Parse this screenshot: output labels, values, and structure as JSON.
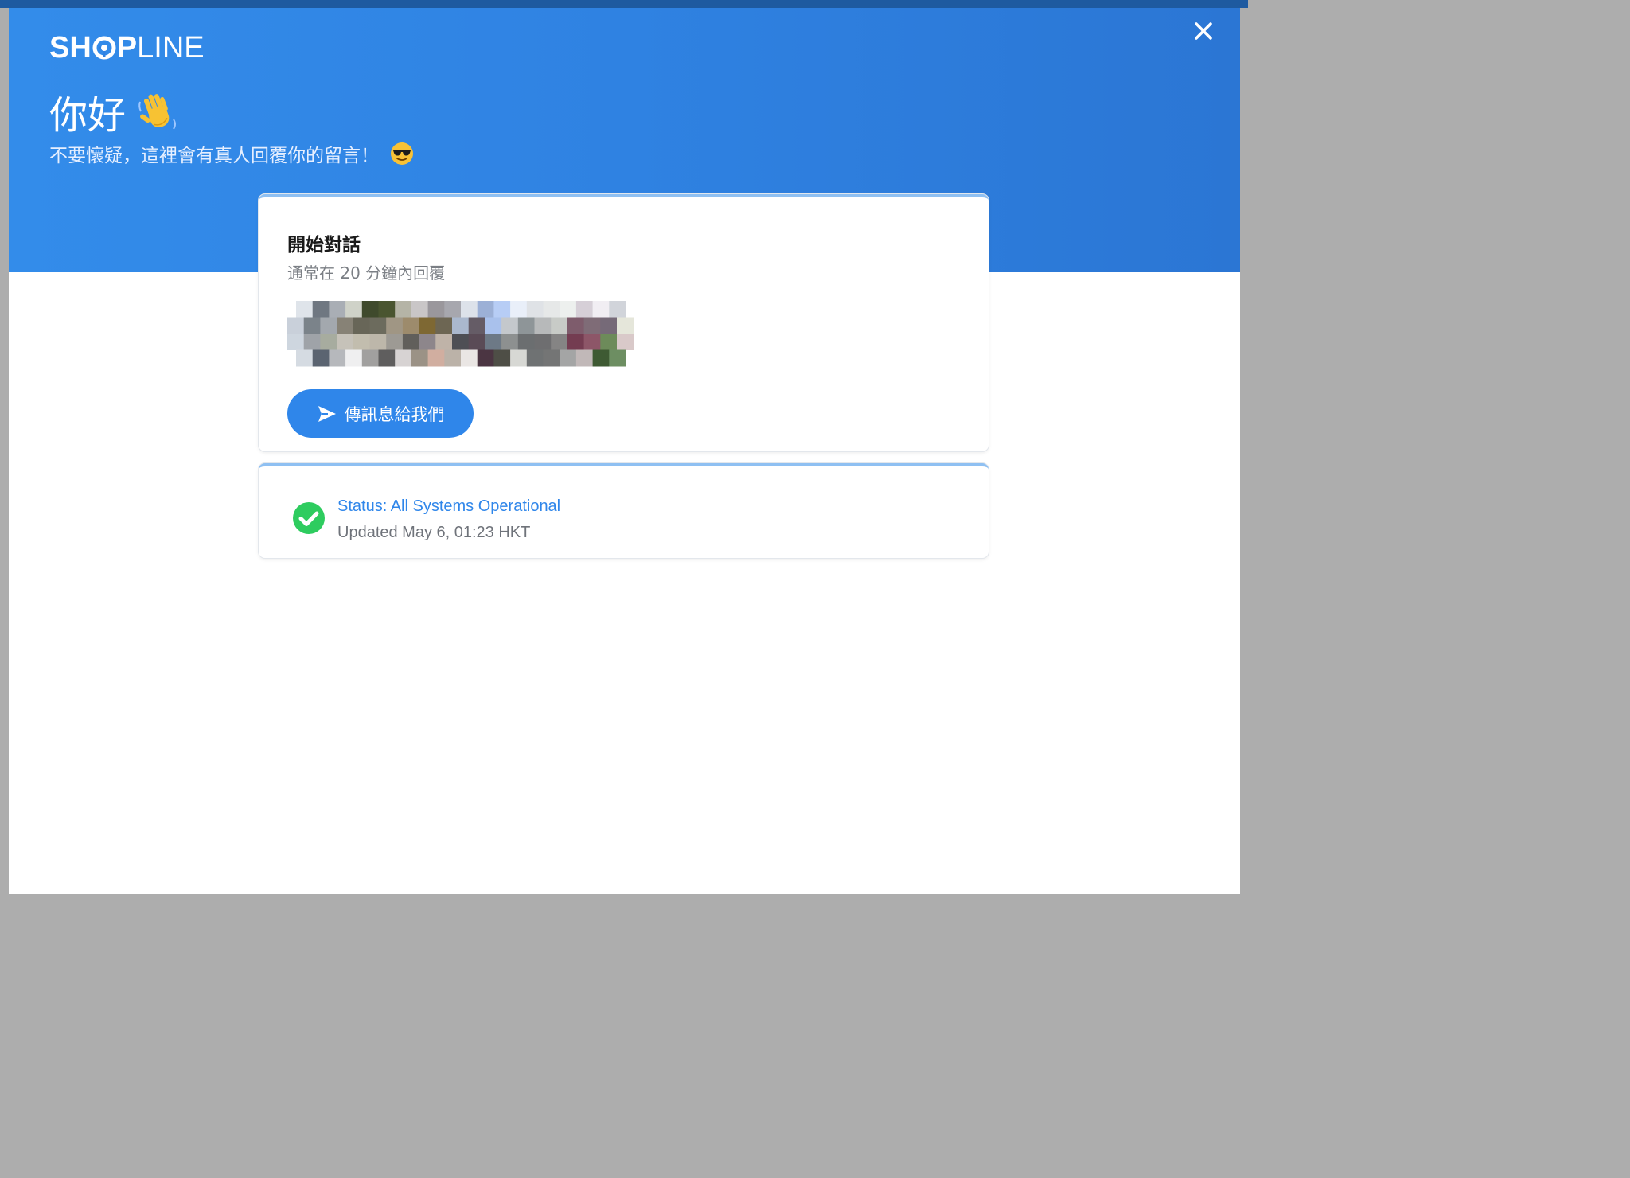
{
  "window": {
    "brand": {
      "bold_part": "SHOP",
      "light_part": "LINE"
    },
    "close_icon": "close-icon"
  },
  "header": {
    "greeting": "你好",
    "greeting_emoji": "waving-hand-icon",
    "subtitle": "不要懷疑，這裡會有真人回覆你的留言！",
    "subtitle_emoji": "sunglasses-face-icon"
  },
  "conversation": {
    "title": "開始對話",
    "reply_time": "通常在 20 分鐘內回覆",
    "avatars": "team-avatars",
    "send_button_label": "傳訊息給我們",
    "send_icon": "send-icon"
  },
  "status": {
    "title": "Status: All Systems Operational",
    "updated": "Updated May 6, 01:23 HKT",
    "icon": "check-circle-icon"
  },
  "colors": {
    "header_blue": "#2f82e2",
    "accent_blue": "#2f86ea",
    "status_green": "#2ecc5f"
  }
}
